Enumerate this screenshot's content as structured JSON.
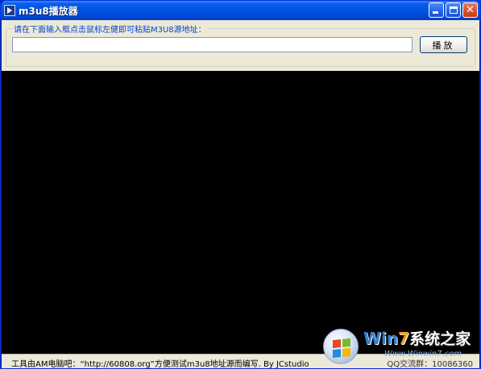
{
  "window": {
    "title": "m3u8播放器",
    "icon": "player-app-icon",
    "caption_buttons": [
      "minimize-icon",
      "maximize-icon",
      "close-icon"
    ],
    "close_glyph": "✕"
  },
  "input_group": {
    "legend": "请在下面输入框点击鼠标左健即可粘贴M3U8源地址：",
    "url_value": "",
    "play_label": "播放"
  },
  "statusbar": {
    "left_text": "工具由AM电脑吧：“http://60808.org”方便测试m3u8地址源而编写.  By JCstudio",
    "right_text": "QQ交流群：10086360"
  },
  "watermark": {
    "brand_prefix": "Win",
    "brand_seven": "7",
    "brand_suffix": "系统之家",
    "url": "Www.Winwin7.com"
  },
  "colors": {
    "titlebar": "#0055e5",
    "panel": "#ece9d8",
    "legend_text": "#0046d5",
    "video_background": "#000000"
  }
}
